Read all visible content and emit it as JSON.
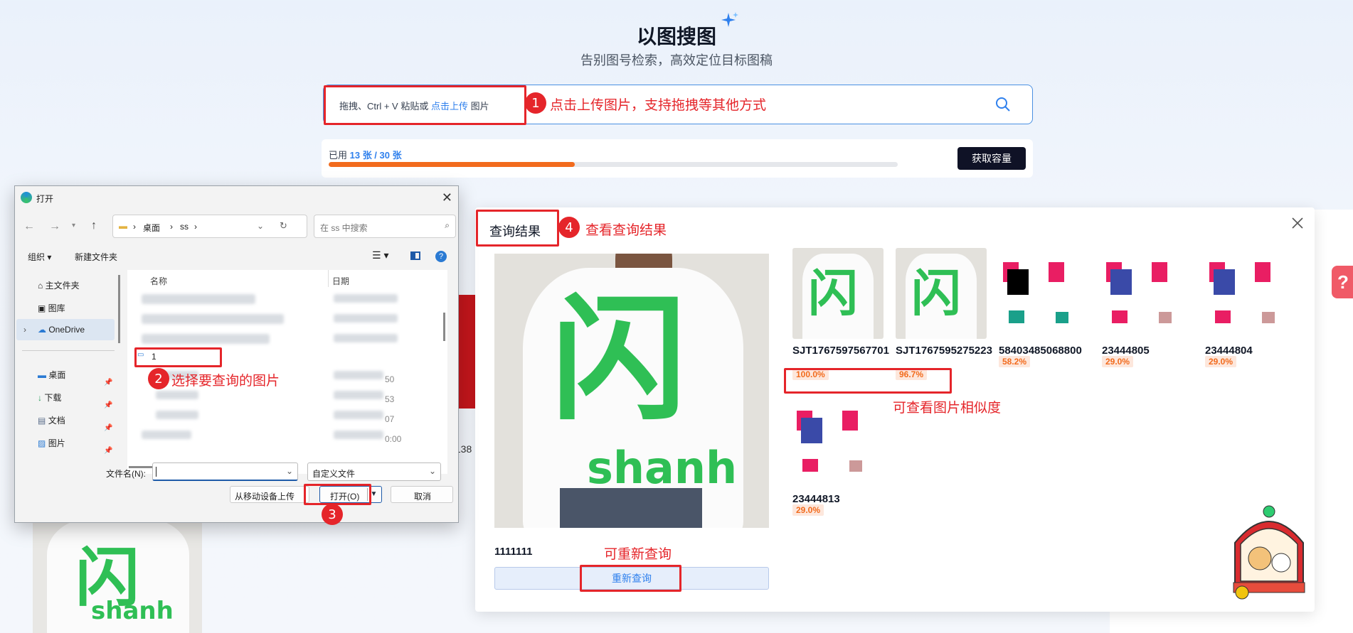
{
  "header": {
    "title": "以图搜图",
    "subtitle": "告别图号检索，高效定位目标图稿"
  },
  "search": {
    "prefix": "拖拽、Ctrl + V 粘贴或 ",
    "link": "点击上传",
    "suffix": " 图片"
  },
  "quota": {
    "used_prefix": "已用 ",
    "used_value": "13 张 / 30 张",
    "progress": 0.433,
    "button": "获取容量"
  },
  "annotations": {
    "a1_num": "1",
    "a1_text": "点击上传图片，支持拖拽等其他方式",
    "a2_num": "2",
    "a2_text": "选择要查询的图片",
    "a3_num": "3",
    "a4_num": "4",
    "a4_text": "查看查询结果",
    "sim_text": "可查看图片相似度",
    "requery_text": "可重新查询"
  },
  "result": {
    "title": "查询结果",
    "query_name": "1111111",
    "requery_button": "重新查询",
    "items": [
      {
        "code": "SJT1767597567701",
        "pct": "100.0%"
      },
      {
        "code": "SJT1767595275223",
        "pct": "96.7%"
      },
      {
        "code": "58403485068800",
        "pct": "58.2%"
      },
      {
        "code": "23444805",
        "pct": "29.0%"
      },
      {
        "code": "23444804",
        "pct": "29.0%"
      },
      {
        "code": "23444813",
        "pct": "29.0%"
      }
    ],
    "shirt_text_a": "闪",
    "shirt_text_b": "shanh"
  },
  "background": {
    "partial_text": "/138"
  },
  "dialog": {
    "title": "打开",
    "path": [
      "桌面",
      "ss"
    ],
    "search_placeholder": "在 ss 中搜索",
    "organize": "组织",
    "new_folder": "新建文件夹",
    "col_name": "名称",
    "col_date": "日期",
    "nav": [
      "主文件夹",
      "图库",
      "OneDrive",
      "桌面",
      "下载",
      "文档",
      "图片"
    ],
    "selected_file": "1",
    "filename_label": "文件名(N):",
    "filetype": "自定义文件",
    "mobile_upload": "从移动设备上传",
    "open": "打开(O)",
    "cancel": "取消",
    "date_fragments": [
      "50",
      "53",
      "07",
      "0:00"
    ]
  },
  "colors": {
    "accent": "#2f80ed",
    "annotation": "#e5252a",
    "progress": "#f26b1d",
    "button_dark": "#111827",
    "similarity_bg": "#fde7dc"
  }
}
